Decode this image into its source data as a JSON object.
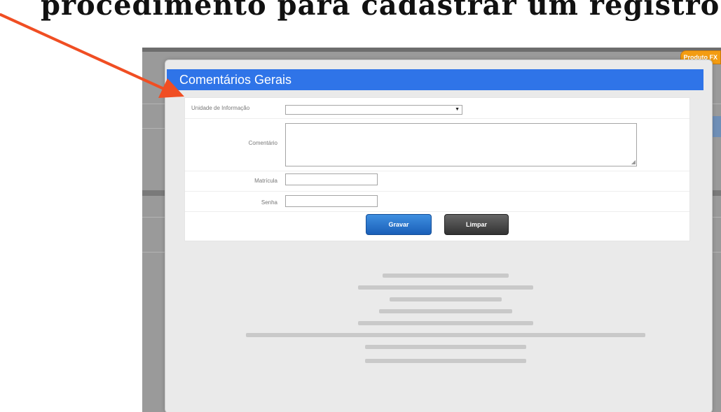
{
  "page": {
    "top_cut_text": "procedimento para cadastrar um registro"
  },
  "badge": {
    "label": "Produto FX"
  },
  "modal": {
    "title": "Comentários Gerais",
    "fields": {
      "unidade_label": "Unidade de Informação",
      "unidade_value": "",
      "comentario_label": "Comentário",
      "comentario_value": "",
      "matricula_label": "Matrícula",
      "matricula_value": "",
      "senha_label": "Senha",
      "senha_value": ""
    },
    "buttons": {
      "save_label": "Gravar",
      "clear_label": "Limpar"
    }
  },
  "colors": {
    "title_bar": "#2f74e8",
    "arrow": "#f04e23",
    "save_button": "#1a5fb8",
    "clear_button": "#333333",
    "badge": "#f39c12"
  }
}
